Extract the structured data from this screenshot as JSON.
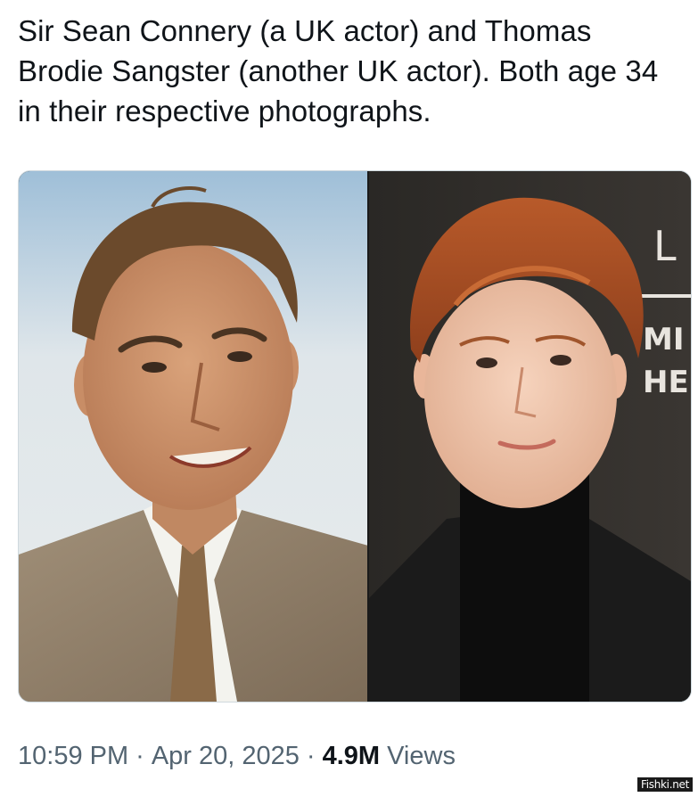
{
  "tweet": {
    "text": "Sir Sean Connery (a UK actor) and Thomas Brodie Sangster (another UK actor). Both age 34 in their respective photographs."
  },
  "media": {
    "left_photo_icon": "portrait-photo",
    "right_photo_icon": "portrait-photo",
    "backdrop_text": [
      "L",
      "MI",
      "HE"
    ]
  },
  "meta": {
    "time": "10:59 PM",
    "separator": "·",
    "date": "Apr 20, 2025",
    "views_count": "4.9M",
    "views_label": "Views"
  },
  "watermark": "Fishki.net",
  "colors": {
    "text_primary": "#0f1419",
    "text_secondary": "#536471",
    "media_border": "#cfd9de"
  }
}
